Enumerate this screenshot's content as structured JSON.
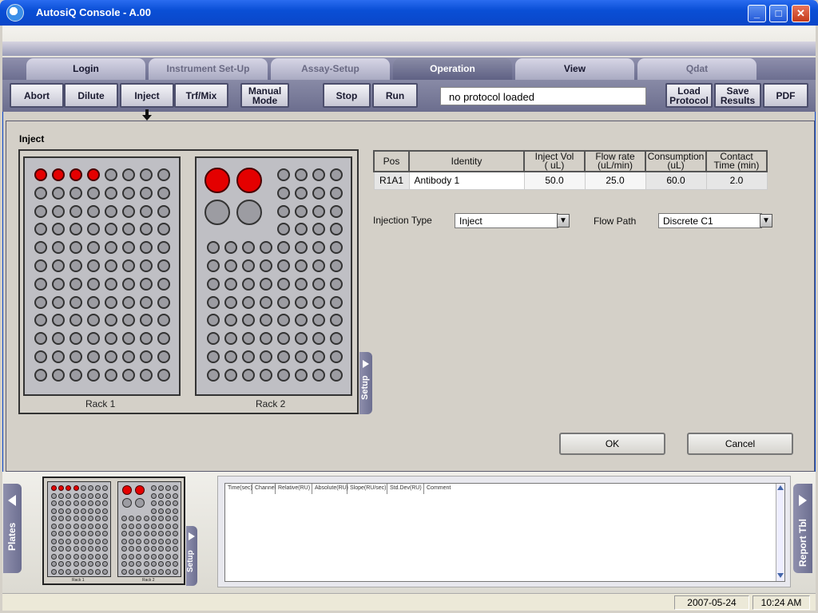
{
  "window": {
    "title": "AutosiQ Console - A.00",
    "minimize": "_",
    "maximize": "□",
    "close": "✕"
  },
  "tabs": [
    {
      "label": "Login"
    },
    {
      "label": "Instrument Set-Up"
    },
    {
      "label": "Assay-Setup"
    },
    {
      "label": "Operation"
    },
    {
      "label": "View"
    },
    {
      "label": "Qdat"
    }
  ],
  "toolbar": {
    "abort": "Abort",
    "dilute": "Dilute",
    "inject": "Inject",
    "trfmix": "Trf/Mix",
    "manual_1": "Manual",
    "manual_2": "Mode",
    "stop": "Stop",
    "run": "Run",
    "protocol_status": "no protocol loaded",
    "load_1": "Load",
    "load_2": "Protocol",
    "save_1": "Save",
    "save_2": "Results",
    "pdf": "PDF"
  },
  "inject": {
    "title": "Inject",
    "rack1_label": "Rack 1",
    "rack2_label": "Rack 2",
    "setup_tab": "Setup",
    "table": {
      "headers": [
        "Pos",
        "Identity",
        "Inject Vol",
        "( uL)",
        "Flow rate",
        "(uL/min)",
        "Consumption",
        "(uL)",
        "Contact",
        "Time (min)"
      ],
      "row": {
        "pos": "R1A1",
        "identity": "Antibody 1",
        "inject_vol": "50.0",
        "flow_rate": "25.0",
        "consumption": "60.0",
        "contact_time": "2.0"
      }
    },
    "injection_type_label": "Injection Type",
    "injection_type_value": "Inject",
    "flow_path_label": "Flow Path",
    "flow_path_value": "Discrete C1",
    "ok": "OK",
    "cancel": "Cancel"
  },
  "bottom": {
    "plates_tab": "Plates",
    "report_tab": "Report Tbl",
    "mini_setup_tab": "Setup",
    "mini_rack1": "Rack 1",
    "mini_rack2": "Rack 2",
    "log_columns": [
      "Time(sec)",
      "Channel",
      "Relative(RU)",
      "Absolute(RU)",
      "Slope(RU/sec)",
      "Std.Dev(RU)",
      "Comment"
    ]
  },
  "status": {
    "date": "2007-05-24",
    "time": "10:24 AM"
  },
  "rack_state": {
    "rack1_red": [
      0,
      1,
      2,
      3
    ],
    "rack2_large_red": [
      0,
      1
    ]
  }
}
